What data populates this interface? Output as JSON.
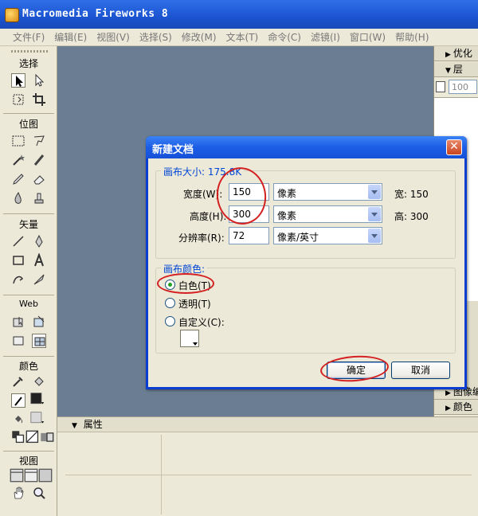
{
  "window": {
    "title": "Macromedia Fireworks 8"
  },
  "menu": [
    "文件(F)",
    "编辑(E)",
    "视图(V)",
    "选择(S)",
    "修改(M)",
    "文本(T)",
    "命令(C)",
    "滤镜(I)",
    "窗口(W)",
    "帮助(H)"
  ],
  "tools": {
    "select": "选择",
    "bitmap": "位图",
    "vector": "矢量",
    "web": "Web",
    "colors": "颜色",
    "view": "视图"
  },
  "right_panels": {
    "optimize": "优化",
    "layers": "层",
    "opacity": "100",
    "image_edit": "图像编",
    "colors": "颜色"
  },
  "properties": {
    "title": "属性"
  },
  "dialog": {
    "title": "新建文档",
    "canvas_size_label": "画布大小: 175.8K",
    "width_label": "宽度(W):",
    "width_value": "150",
    "width_unit": "像素",
    "width_readout_label": "宽:",
    "width_readout": "150",
    "height_label": "高度(H):",
    "height_value": "300",
    "height_unit": "像素",
    "height_readout_label": "高:",
    "height_readout": "300",
    "resolution_label": "分辨率(R):",
    "resolution_value": "72",
    "resolution_unit": "像素/英寸",
    "canvas_color_label": "画布颜色:",
    "white": "白色(T)",
    "transparent": "透明(T)",
    "custom": "自定义(C):",
    "ok": "确定",
    "cancel": "取消",
    "selected_option": "white"
  }
}
